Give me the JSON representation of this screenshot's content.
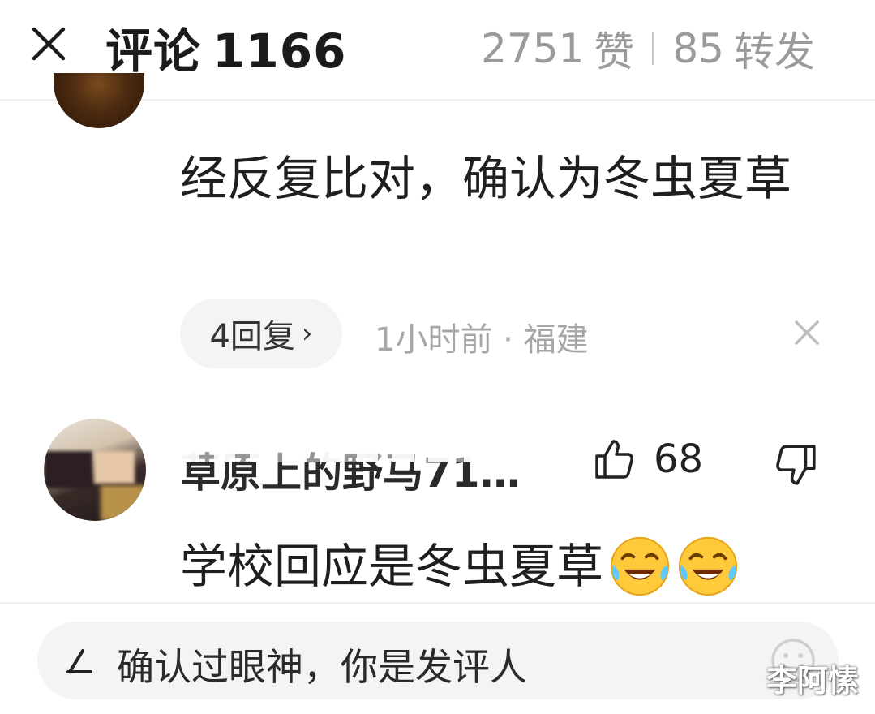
{
  "header": {
    "title": "评论",
    "comment_count": "1166",
    "likes_count": "2751",
    "likes_label": "赞",
    "reposts_count": "85",
    "reposts_label": "转发"
  },
  "comments": [
    {
      "text": "经反复比对，确认为冬虫夏草",
      "reply_label": "4回复",
      "time": "1小时前",
      "location": "福建"
    },
    {
      "username": "草原上的野马71…",
      "likes": "68",
      "text": "学校回应是冬虫夏草"
    }
  ],
  "input": {
    "text": "确认过眼神，你是发评人"
  },
  "watermark": "李阿愫",
  "icons": {
    "close": "close-icon",
    "like": "thumbs-up-icon",
    "dislike": "thumbs-down-icon",
    "pen": "pen-icon",
    "emoji": "smiley-icon",
    "emoji_in_text": "laughing-crying-emoji-icon"
  },
  "colors": {
    "text_primary": "#1f1f1f",
    "text_secondary": "#a6a6a6",
    "pill_bg": "#f4f4f4",
    "emoji_yellow": "#ffc93c"
  }
}
